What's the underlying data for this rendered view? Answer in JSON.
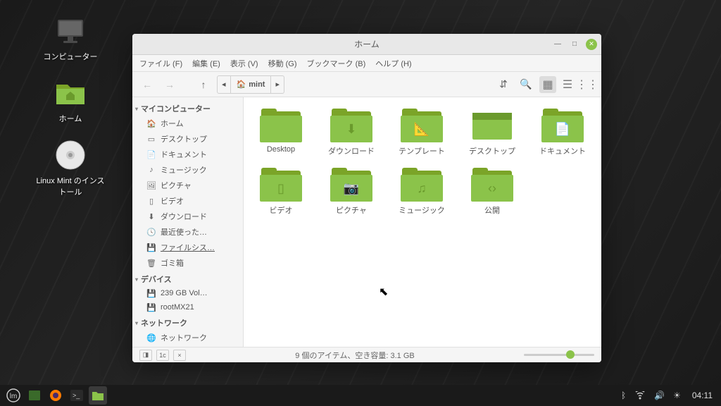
{
  "desktop": {
    "icons": [
      {
        "label": "コンピューター",
        "kind": "computer"
      },
      {
        "label": "ホーム",
        "kind": "home-folder"
      },
      {
        "label": "Linux Mint のインストール",
        "kind": "disc"
      }
    ]
  },
  "window": {
    "title": "ホーム",
    "menubar": [
      "ファイル (F)",
      "編集 (E)",
      "表示 (V)",
      "移動 (G)",
      "ブックマーク (B)",
      "ヘルプ (H)"
    ],
    "path_label": "mint",
    "sidebar": {
      "sections": [
        {
          "title": "マイコンピューター",
          "items": [
            {
              "icon": "home",
              "label": "ホーム"
            },
            {
              "icon": "desktop",
              "label": "デスクトップ"
            },
            {
              "icon": "documents",
              "label": "ドキュメント"
            },
            {
              "icon": "music",
              "label": "ミュージック"
            },
            {
              "icon": "pictures",
              "label": "ピクチャ"
            },
            {
              "icon": "videos",
              "label": "ビデオ"
            },
            {
              "icon": "downloads",
              "label": "ダウンロード"
            },
            {
              "icon": "recent",
              "label": "最近使った…"
            },
            {
              "icon": "filesystem",
              "label": "ファイルシス…",
              "underlined": true
            },
            {
              "icon": "trash",
              "label": "ゴミ箱"
            }
          ]
        },
        {
          "title": "デバイス",
          "items": [
            {
              "icon": "disk",
              "label": "239 GB Vol…"
            },
            {
              "icon": "disk",
              "label": "rootMX21"
            }
          ]
        },
        {
          "title": "ネットワーク",
          "items": [
            {
              "icon": "network",
              "label": "ネットワーク"
            }
          ]
        }
      ]
    },
    "folders": [
      {
        "name": "Desktop",
        "glyph": ""
      },
      {
        "name": "ダウンロード",
        "glyph": "⬇"
      },
      {
        "name": "テンプレート",
        "glyph": "📐"
      },
      {
        "name": "デスクトップ",
        "glyph": "",
        "variant": "desktop"
      },
      {
        "name": "ドキュメント",
        "glyph": "📄"
      },
      {
        "name": "ビデオ",
        "glyph": "▯"
      },
      {
        "name": "ピクチャ",
        "glyph": "📷"
      },
      {
        "name": "ミュージック",
        "glyph": "♫"
      },
      {
        "name": "公開",
        "glyph": "‹›"
      }
    ],
    "status": "9 個のアイテム、空き容量: 3.1 GB"
  },
  "taskbar": {
    "clock": "04:11"
  }
}
